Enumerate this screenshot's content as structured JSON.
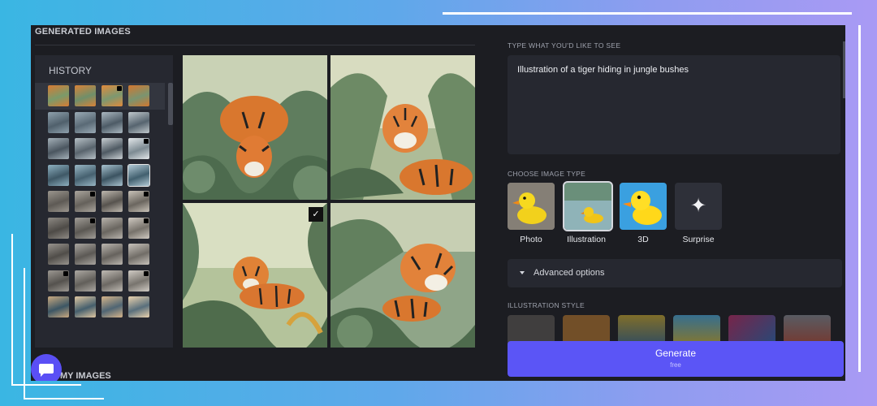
{
  "colors": {
    "accent": "#5b55f6",
    "panel": "#1c1d22",
    "card": "#262830"
  },
  "generated": {
    "title": "GENERATED IMAGES",
    "images": [
      {
        "alt": "tiger in jungle bushes 1",
        "selected": false
      },
      {
        "alt": "tiger in jungle bushes 2",
        "selected": false
      },
      {
        "alt": "tiger in jungle bushes 3",
        "selected": true
      },
      {
        "alt": "tiger in jungle bushes 4",
        "selected": false
      }
    ],
    "check_icon": "✓"
  },
  "history": {
    "title": "HISTORY"
  },
  "my_images": {
    "title": "MY IMAGES"
  },
  "prompt": {
    "label": "TYPE WHAT YOU'D LIKE TO SEE",
    "text": "Illustration of a tiger hiding in jungle bushes"
  },
  "image_type": {
    "label": "CHOOSE IMAGE TYPE",
    "options": [
      {
        "name": "Photo"
      },
      {
        "name": "Illustration",
        "selected": true
      },
      {
        "name": "3D"
      },
      {
        "name": "Surprise"
      }
    ]
  },
  "advanced": {
    "label": "Advanced options"
  },
  "illustration_style": {
    "label": "ILLUSTRATION STYLE"
  },
  "generate": {
    "label": "Generate",
    "sub": "free"
  },
  "icons": {
    "chat": "chat-icon",
    "sparkle": "✦"
  }
}
